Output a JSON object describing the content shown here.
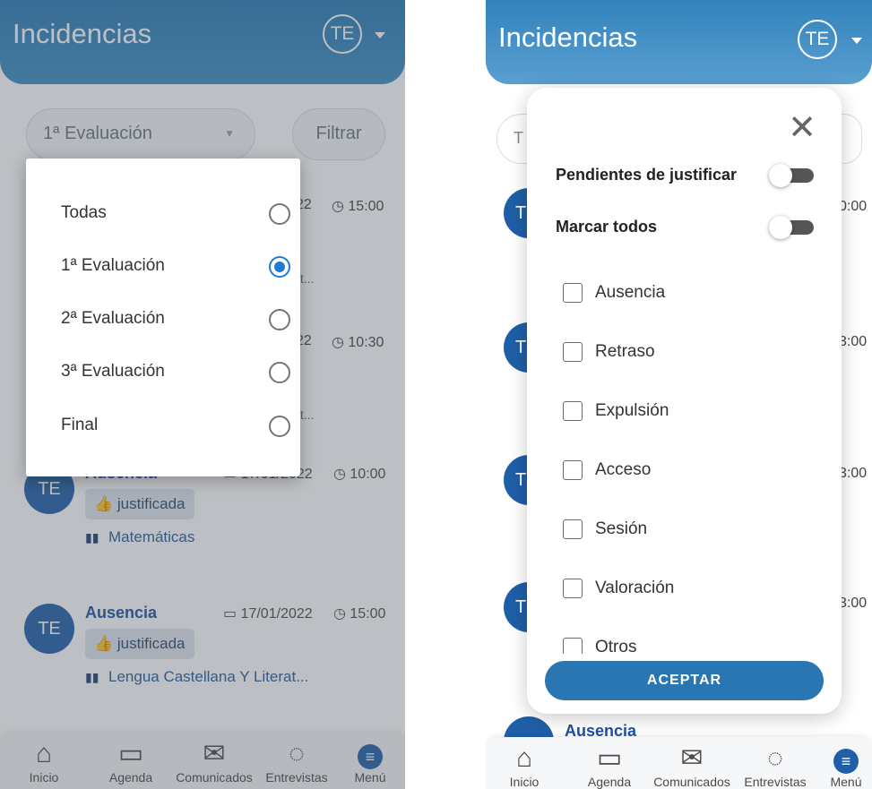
{
  "left": {
    "header": {
      "title": "Incidencias",
      "avatar": "TE"
    },
    "period_select": {
      "value": "1ª Evaluación",
      "icon": "chevron-down-icon"
    },
    "filter_button": "Filtrar",
    "dropdown_options": [
      {
        "label": "Todas",
        "selected": false
      },
      {
        "label": "1ª Evaluación",
        "selected": true
      },
      {
        "label": "2ª Evaluación",
        "selected": false
      },
      {
        "label": "3ª Evaluación",
        "selected": false
      },
      {
        "label": "Final",
        "selected": false
      }
    ],
    "background_incidents": [
      {
        "time": "15:00",
        "date": "22",
        "subject": "t..."
      },
      {
        "time": "10:30",
        "date": "22",
        "subject": "t..."
      }
    ],
    "incidents": [
      {
        "avatar": "TE",
        "type": "Ausencia",
        "date": "17/01/2022",
        "time": "10:00",
        "badge": "justificada",
        "subject": "Matemáticas"
      },
      {
        "avatar": "TE",
        "type": "Ausencia",
        "date": "17/01/2022",
        "time": "15:00",
        "badge": "justificada",
        "subject": "Lengua Castellana Y Literat..."
      }
    ]
  },
  "right": {
    "header": {
      "title": "Incidencias",
      "avatar": "TE"
    },
    "modal": {
      "close_icon": "close-icon",
      "toggles": [
        {
          "label": "Pendientes de justificar",
          "on": false
        },
        {
          "label": "Marcar todos",
          "on": false
        }
      ],
      "checkboxes": [
        "Ausencia",
        "Retraso",
        "Expulsión",
        "Acceso",
        "Sesión",
        "Valoración",
        "Otros"
      ],
      "accept_button": "ACEPTAR"
    },
    "behind": {
      "search_start": "T",
      "avatar_letter": "T",
      "times": [
        "0:00",
        "3:00",
        "3:00",
        "3:00"
      ],
      "bottom_type": "Ausencia"
    }
  },
  "nav": [
    {
      "label": "Inicio",
      "icon": "home-icon"
    },
    {
      "label": "Agenda",
      "icon": "calendar-icon"
    },
    {
      "label": "Comunicados",
      "icon": "envelope-icon"
    },
    {
      "label": "Entrevistas",
      "icon": "chat-icon"
    },
    {
      "label": "Menú",
      "icon": "menu-icon"
    }
  ]
}
